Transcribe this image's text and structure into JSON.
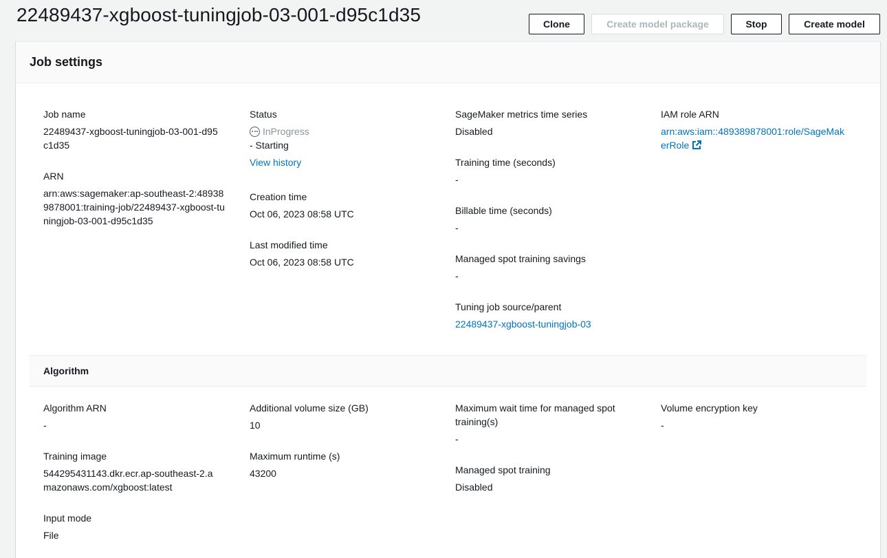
{
  "header": {
    "title": "22489437-xgboost-tuningjob-03-001-d95c1d35",
    "buttons": {
      "clone": "Clone",
      "create_model_package": "Create model package",
      "stop": "Stop",
      "create_model": "Create model"
    }
  },
  "job_settings": {
    "title": "Job settings",
    "job_name": {
      "label": "Job name",
      "value": "22489437-xgboost-tuningjob-03-001-d95c1d35"
    },
    "arn": {
      "label": "ARN",
      "value": "arn:aws:sagemaker:ap-southeast-2:489389878001:training-job/22489437-xgboost-tuningjob-03-001-d95c1d35"
    },
    "status": {
      "label": "Status",
      "state": "InProgress",
      "detail": "- Starting",
      "view_history": "View history"
    },
    "creation_time": {
      "label": "Creation time",
      "value": "Oct 06, 2023 08:58 UTC"
    },
    "last_modified_time": {
      "label": "Last modified time",
      "value": "Oct 06, 2023 08:58 UTC"
    },
    "metrics_time_series": {
      "label": "SageMaker metrics time series",
      "value": "Disabled"
    },
    "training_time": {
      "label": "Training time (seconds)",
      "value": "-"
    },
    "billable_time": {
      "label": "Billable time (seconds)",
      "value": "-"
    },
    "spot_savings": {
      "label": "Managed spot training savings",
      "value": "-"
    },
    "tuning_source": {
      "label": "Tuning job source/parent",
      "value": "22489437-xgboost-tuningjob-03"
    },
    "iam_role": {
      "label": "IAM role ARN",
      "value": "arn:aws:iam::489389878001:role/SageMakerRole"
    }
  },
  "algorithm": {
    "title": "Algorithm",
    "algorithm_arn": {
      "label": "Algorithm ARN",
      "value": "-"
    },
    "training_image": {
      "label": "Training image",
      "value": "544295431143.dkr.ecr.ap-southeast-2.amazonaws.com/xgboost:latest"
    },
    "input_mode": {
      "label": "Input mode",
      "value": "File"
    },
    "volume_size": {
      "label": "Additional volume size (GB)",
      "value": "10"
    },
    "max_runtime": {
      "label": "Maximum runtime (s)",
      "value": "43200"
    },
    "max_wait_time": {
      "label": "Maximum wait time for managed spot training(s)",
      "value": "-"
    },
    "managed_spot": {
      "label": "Managed spot training",
      "value": "Disabled"
    },
    "volume_key": {
      "label": "Volume encryption key",
      "value": "-"
    }
  },
  "colors": {
    "link": "#0073bb",
    "status_muted": "#879596",
    "disabled_text": "#aab7b8"
  }
}
